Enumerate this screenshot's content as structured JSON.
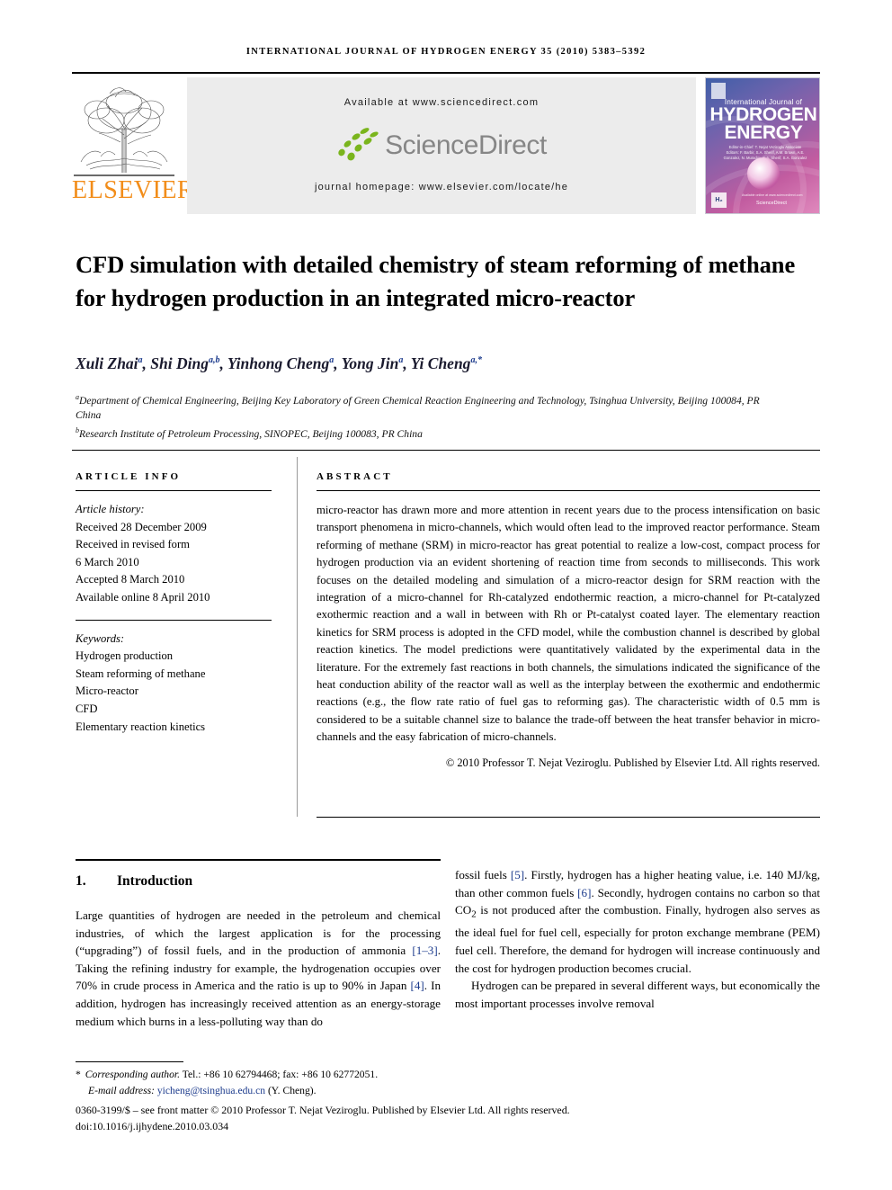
{
  "running_head": "International Journal of Hydrogen Energy 35 (2010) 5383–5392",
  "masthead": {
    "publisher_name": "ELSEVIER",
    "available_at": "Available at www.sciencedirect.com",
    "sciencedirect_wordmark": "ScienceDirect",
    "journal_homepage": "journal homepage: www.elsevier.com/locate/he",
    "cover": {
      "line1": "International Journal of",
      "line2": "HYDROGEN",
      "line3": "ENERGY",
      "editors": "Editor-in-Chief: T. Nejat Veziroglu    Associate Editors: F. Barbir, S.A. Sherif, A.M. Brown, A.E. Gonzalez, N. Muradov, S.A. Sherif, S.A. Gonzalez",
      "he_mark": "H₂",
      "sciencedirect_tag": "ScienceDirect",
      "footer_note": "Available online at www.sciencedirect.com"
    },
    "colors": {
      "elsevier_orange": "#F28D1A",
      "sciencedirect_green": "#7AB51D",
      "sciencedirect_gray": "#868686",
      "band_gray": "#ececec"
    }
  },
  "article": {
    "title": "CFD simulation with detailed chemistry of steam reforming of methane for hydrogen production in an integrated micro-reactor",
    "authors_html": "Xuli Zhai<sup>a</sup>, Shi Ding<sup>a,b</sup>, Yinhong Cheng<sup>a</sup>, Yong Jin<sup>a</sup>, Yi Cheng<sup>a,*</sup>",
    "affiliations_html": "<sup>a</sup>Department of Chemical Engineering, Beijing Key Laboratory of Green Chemical Reaction Engineering and Technology, Tsinghua University, Beijing 100084, PR China<br><sup>b</sup>Research Institute of Petroleum Processing, SINOPEC, Beijing 100083, PR China"
  },
  "article_info": {
    "heading": "ARTICLE INFO",
    "history_label": "Article history:",
    "history": [
      "Received 28 December 2009",
      "Received in revised form",
      "6 March 2010",
      "Accepted 8 March 2010",
      "Available online 8 April 2010"
    ],
    "keywords_label": "Keywords:",
    "keywords": [
      "Hydrogen production",
      "Steam reforming of methane",
      "Micro-reactor",
      "CFD",
      "Elementary reaction kinetics"
    ]
  },
  "abstract": {
    "heading": "ABSTRACT",
    "body": "micro-reactor has drawn more and more attention in recent years due to the process intensification on basic transport phenomena in micro-channels, which would often lead to the improved reactor performance. Steam reforming of methane (SRM) in micro-reactor has great potential to realize a low-cost, compact process for hydrogen production via an evident shortening of reaction time from seconds to milliseconds. This work focuses on the detailed modeling and simulation of a micro-reactor design for SRM reaction with the integration of a micro-channel for Rh-catalyzed endothermic reaction, a micro-channel for Pt-catalyzed exothermic reaction and a wall in between with Rh or Pt-catalyst coated layer. The elementary reaction kinetics for SRM process is adopted in the CFD model, while the combustion channel is described by global reaction kinetics. The model predictions were quantitatively validated by the experimental data in the literature. For the extremely fast reactions in both channels, the simulations indicated the significance of the heat conduction ability of the reactor wall as well as the interplay between the exothermic and endothermic reactions (e.g., the flow rate ratio of fuel gas to reforming gas). The characteristic width of 0.5 mm is considered to be a suitable channel size to balance the trade-off between the heat transfer behavior in micro-channels and the easy fabrication of micro-channels.",
    "copyright": "© 2010 Professor T. Nejat Veziroglu. Published by Elsevier Ltd. All rights reserved."
  },
  "introduction": {
    "number": "1.",
    "heading": "Introduction",
    "left_paragraph_html": "Large quantities of hydrogen are needed in the petroleum and chemical industries, of which the largest application is for the processing (“upgrading”) of fossil fuels, and in the production of ammonia <span class=\"ref\">[1–3]</span>. Taking the refining industry for example, the hydrogenation occupies over 70% in crude process in America and the ratio is up to 90% in Japan <span class=\"ref\">[4]</span>. In addition, hydrogen has increasingly received attention as an energy-storage medium which burns in a less-polluting way than do",
    "right_paragraph_1_html": "fossil fuels <span class=\"ref\">[5]</span>. Firstly, hydrogen has a higher heating value, i.e. 140 MJ/kg, than other common fuels <span class=\"ref\">[6]</span>. Secondly, hydrogen contains no carbon so that CO<sub>2</sub> is not produced after the combustion. Finally, hydrogen also serves as the ideal fuel for fuel cell, especially for proton exchange membrane (PEM) fuel cell. Therefore, the demand for hydrogen will increase continuously and the cost for hydrogen production becomes crucial.",
    "right_paragraph_2_html": "Hydrogen can be prepared in several different ways, but economically the most important processes involve removal"
  },
  "footer": {
    "corresponding_html": "<span class=\"fn-ital\">Corresponding author.</span> Tel.: +86 10 62794468; fax: +86 10 62772051.",
    "email_label": "E-mail address:",
    "email": "yicheng@tsinghua.edu.cn",
    "email_owner": "(Y. Cheng).",
    "issn_line": "0360-3199/$ – see front matter © 2010 Professor T. Nejat Veziroglu. Published by Elsevier Ltd. All rights reserved.",
    "doi_line": "doi:10.1016/j.ijhydene.2010.03.034",
    "link_color": "#1b3a8c"
  }
}
